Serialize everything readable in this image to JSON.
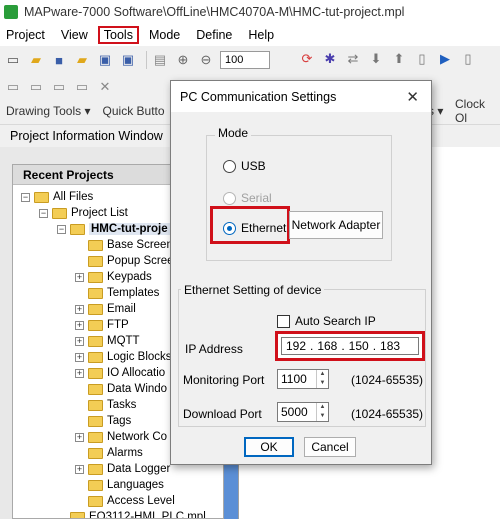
{
  "window": {
    "title": "MAPware-7000 Software\\OffLine\\HMC4070A-M\\HMC-tut-project.mpl"
  },
  "menu": [
    "Project",
    "View",
    "Tools",
    "Mode",
    "Define",
    "Help"
  ],
  "toolbar": {
    "zoom": "100"
  },
  "labelbar": {
    "drawing_tools": "Drawing Tools ▾",
    "quick_buttons": "Quick Butto",
    "clock": "Clock Ol",
    "partial": "s ▾"
  },
  "project_info": {
    "label": "Project Information Window"
  },
  "recent": {
    "title": "Recent Projects",
    "all_files": "All Files",
    "project_list": "Project List",
    "current_project": "HMC-tut-proje",
    "items": [
      "Base Screen",
      "Popup Scree",
      "Keypads",
      "Templates",
      "Email",
      "FTP",
      "MQTT",
      "Logic Blocks",
      "IO Allocatio",
      "Data Windo",
      "Tasks",
      "Tags",
      "Network Co",
      "Alarms",
      "Data Logger",
      "Languages",
      "Access Level"
    ],
    "other_project": "EQ3112-HMI_PLC.mpl"
  },
  "dialog": {
    "title": "PC Communication Settings",
    "mode_group": "Mode",
    "usb": "USB",
    "serial": "Serial",
    "ethernet": "Ethernet",
    "network_adapter": "Network Adapter",
    "eth_group": "Ethernet Setting of device",
    "auto_search": "Auto Search IP",
    "ip_label": "IP Address",
    "ip": [
      "192",
      "168",
      "150",
      "183"
    ],
    "monitoring_port_label": "Monitoring Port",
    "monitoring_port": "1100",
    "monitoring_range": "(1024-65535)",
    "download_port_label": "Download Port",
    "download_port": "5000",
    "download_range": "(1024-65535)",
    "ok": "OK",
    "cancel": "Cancel"
  }
}
